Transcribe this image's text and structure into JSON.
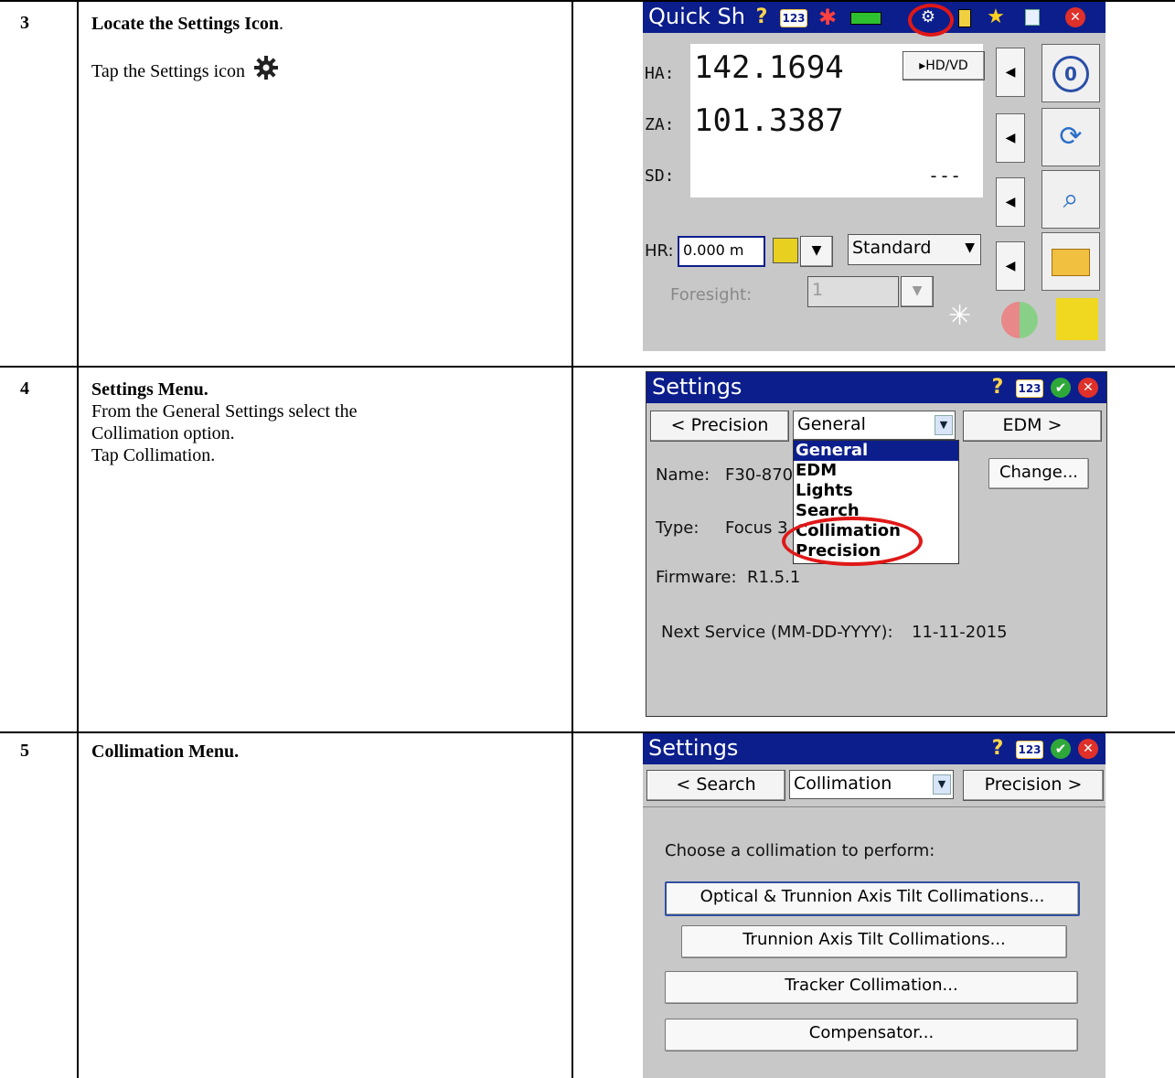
{
  "rows": [
    {
      "step": "3",
      "heading": "Locate the Settings Icon",
      "heading_suffix": ".",
      "lines": [
        "Tap the Settings icon"
      ],
      "icon": "gear-icon"
    },
    {
      "step": "4",
      "heading": "Settings Menu.",
      "lines": [
        "From the General Settings select the",
        "Collimation option.",
        "Tap Collimation."
      ]
    },
    {
      "step": "5",
      "heading": "Collimation Menu.",
      "lines": []
    }
  ],
  "quickshoot": {
    "title": "Quick Sh",
    "toolbar_icons": [
      "help-icon",
      "keypad-123-icon",
      "laser-icon",
      "battery-icon",
      "settings-gear-icon",
      "instrument-icon",
      "favorites-star-icon",
      "clipboard-icon",
      "close-icon"
    ],
    "keypad_label": "123",
    "ha_label": "HA:",
    "ha_value": "142.1694",
    "za_label": "ZA:",
    "za_value": "101.3387",
    "sd_label": "SD:",
    "sd_value": "---",
    "hdvd_button": "▸HD/VD",
    "hr_label": "HR:",
    "hr_value": "0.000 m",
    "mode_value": "Standard",
    "foresight_label": "Foresight:",
    "foresight_value": "1",
    "side_icons": [
      "zero-set-icon",
      "rotate-instrument-icon",
      "search-target-icon",
      "open-folder-icon"
    ],
    "bottom_icons": [
      "laser-pointer-icon",
      "status-circle-icon",
      "prism-target-icon"
    ]
  },
  "settings_general": {
    "title": "Settings",
    "keypad_label": "123",
    "prev_button": "< Precision",
    "combo_value": "General",
    "next_button": "EDM >",
    "dropdown_options": [
      "General",
      "EDM",
      "Lights",
      "Search",
      "Collimation",
      "Precision"
    ],
    "dropdown_selected": "General",
    "name_label": "Name:",
    "name_value": "F30-870",
    "change_button": "Change...",
    "type_label": "Type:",
    "type_value": "Focus 3",
    "firmware_label": "Firmware:",
    "firmware_value": "R1.5.1",
    "service_label": "Next Service (MM-DD-YYYY):",
    "service_value": "11-11-2015"
  },
  "settings_collimation": {
    "title": "Settings",
    "keypad_label": "123",
    "prev_button": "< Search",
    "combo_value": "Collimation",
    "next_button": "Precision >",
    "prompt": "Choose a collimation to perform:",
    "buttons": [
      "Optical & Trunnion Axis Tilt Collimations...",
      "Trunnion Axis Tilt Collimations...",
      "Tracker Collimation...",
      "Compensator..."
    ]
  }
}
